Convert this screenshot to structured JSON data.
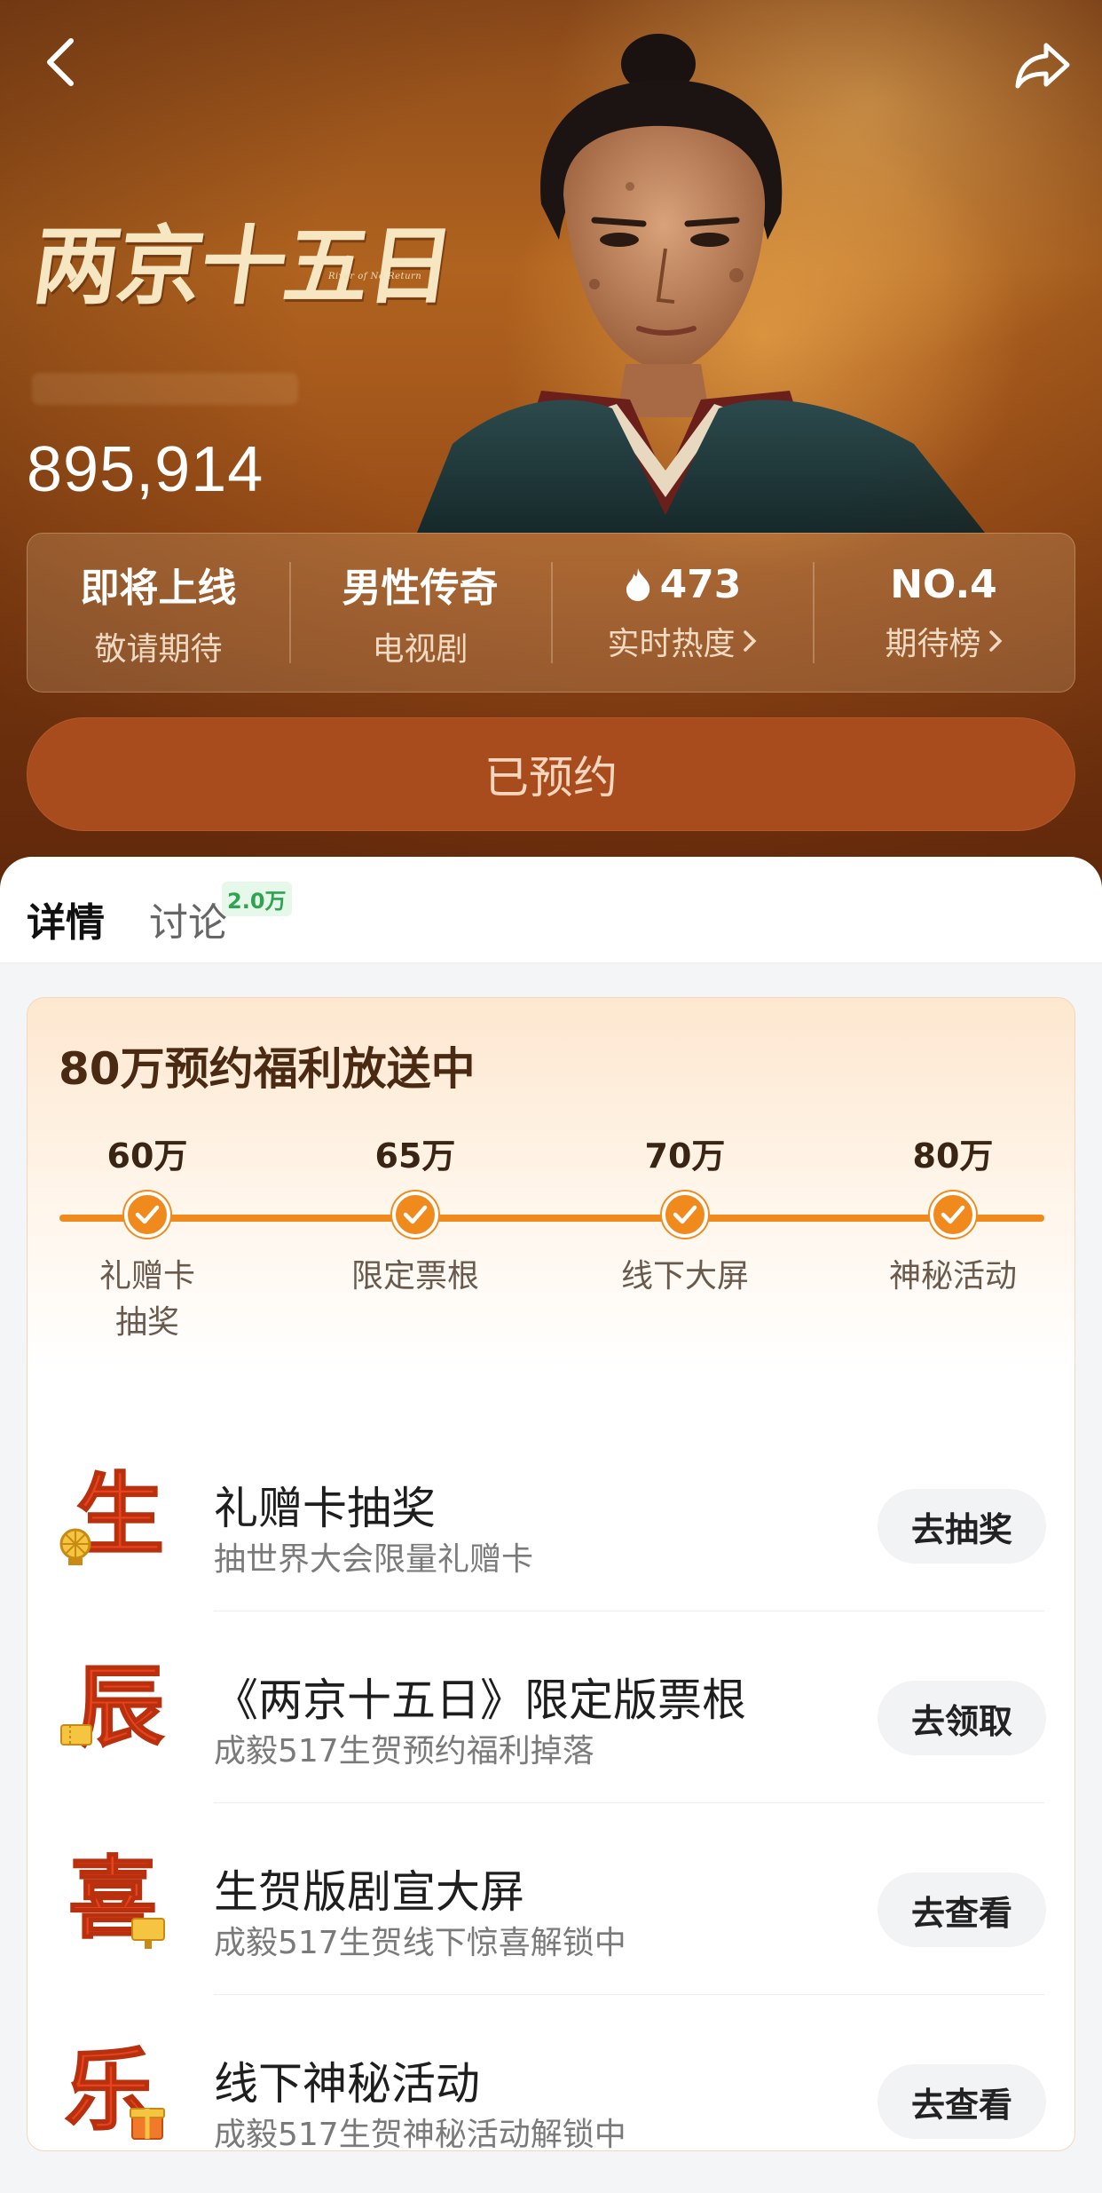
{
  "show": {
    "title_cn": "两京十五日",
    "title_en": "River of No Return",
    "reservation_count": "895,914"
  },
  "stats": [
    {
      "top": "即将上线",
      "bottom": "敬请期待",
      "has_arrow": false
    },
    {
      "top": "男性传奇",
      "bottom": "电视剧",
      "has_arrow": false
    },
    {
      "top": "473",
      "bottom": "实时热度",
      "has_arrow": true,
      "icon": "flame-icon"
    },
    {
      "top": "NO.4",
      "bottom": "期待榜",
      "has_arrow": true
    }
  ],
  "reserve_button": "已预约",
  "tabs": {
    "details": "详情",
    "discussion": "讨论",
    "discussion_badge": "2.0万"
  },
  "welfare": {
    "title": "80万预约福利放送中",
    "milestones": [
      {
        "amount": "60万",
        "label_line1": "礼赠卡",
        "label_line2": "抽奖"
      },
      {
        "amount": "65万",
        "label_line1": "限定票根",
        "label_line2": ""
      },
      {
        "amount": "70万",
        "label_line1": "线下大屏",
        "label_line2": ""
      },
      {
        "amount": "80万",
        "label_line1": "神秘活动",
        "label_line2": ""
      }
    ],
    "rewards": [
      {
        "glyph": "生",
        "title": "礼赠卡抽奖",
        "subtitle": "抽世界大会限量礼赠卡",
        "button": "去抽奖",
        "icon": "wheel-icon"
      },
      {
        "glyph": "辰",
        "title": "《两京十五日》限定版票根",
        "subtitle": "成毅517生贺预约福利掉落",
        "button": "去领取",
        "icon": "ticket-icon"
      },
      {
        "glyph": "喜",
        "title": "生贺版剧宣大屏",
        "subtitle": "成毅517生贺线下惊喜解锁中",
        "button": "去查看",
        "icon": "screen-icon"
      },
      {
        "glyph": "乐",
        "title": "线下神秘活动",
        "subtitle": "成毅517生贺神秘活动解锁中",
        "button": "去查看",
        "icon": "gift-icon"
      }
    ]
  },
  "colors": {
    "accent": "#f08a1c",
    "glyph_red": "#e8431c",
    "hero_bg": "#9a4e18",
    "reserve_btn": "#a84c1e"
  }
}
